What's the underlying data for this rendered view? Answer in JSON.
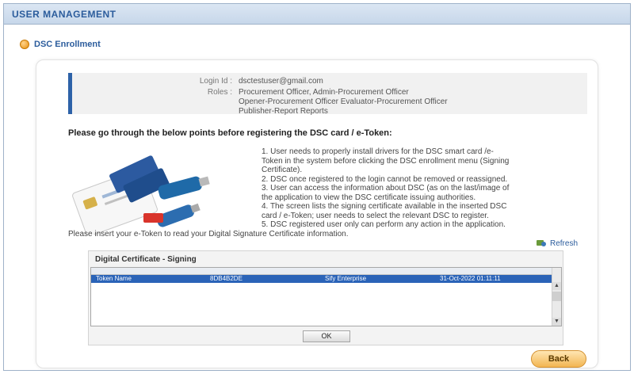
{
  "header": {
    "title": "USER MANAGEMENT"
  },
  "section": {
    "title": "DSC Enrollment"
  },
  "info": {
    "login_label": "Login Id :",
    "login_value": "dsctestuser@gmail.com",
    "roles_label": "Roles :",
    "roles_lines": [
      "Procurement Officer, Admin-Procurement Officer",
      "Opener-Procurement Officer Evaluator-Procurement Officer",
      "Publisher-Report Reports"
    ]
  },
  "instructions_title": "Please go through the below points before registering the DSC card / e-Token:",
  "points": [
    "1. User needs to properly install drivers for the DSC smart card /e-",
    "   Token in the system before clicking the DSC enrollment menu (Signing",
    "   Certificate).",
    "2. DSC once registered to the login cannot be removed or reassigned.",
    "3. User can access the information about DSC (as on the last/image of",
    "   the application to view the DSC certificate issuing authorities.",
    "4. The screen lists the signing certificate available in the inserted DSC",
    "   card / e-Token; user needs to select the relevant DSC to register.",
    "5. DSC registered user only can perform any action in the application."
  ],
  "insert_text": "Please insert your e-Token to read your Digital Signature Certificate information.",
  "refresh_label": "Refresh",
  "cert_dialog": {
    "title": "Digital Certificate - Signing",
    "row": {
      "name": "Token Name",
      "serial": "8DB4B2DE",
      "issuer": "Sify Enterprise",
      "date": "31-Oct-2022 01:11:11"
    },
    "ok_label": "OK"
  },
  "back_label": "Back"
}
